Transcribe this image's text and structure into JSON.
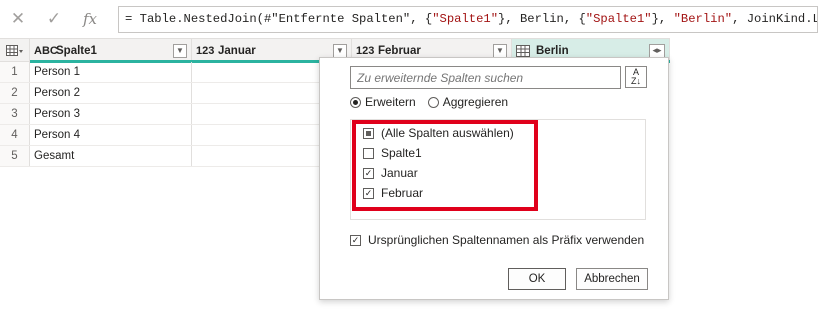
{
  "formula_bar": {
    "icons": [
      "cancel-icon",
      "confirm-icon",
      "fx-icon"
    ],
    "cancel_glyph": "✕",
    "confirm_glyph": "✓",
    "fx_glyph": "fx",
    "formula_parts": [
      {
        "text": "= Table.NestedJoin(#\"Entfernte Spalten\", {",
        "kind": "plain"
      },
      {
        "text": "\"Spalte1\"",
        "kind": "string"
      },
      {
        "text": "}, Berlin, {",
        "kind": "plain"
      },
      {
        "text": "\"Spalte1\"",
        "kind": "string"
      },
      {
        "text": "}, ",
        "kind": "plain"
      },
      {
        "text": "\"Berlin\"",
        "kind": "string"
      },
      {
        "text": ", JoinKind.LeftOuter)",
        "kind": "plain"
      }
    ]
  },
  "grid": {
    "columns": [
      {
        "type_label": "ABC",
        "name": "Spalte1"
      },
      {
        "type_label": "123",
        "name": "Januar"
      },
      {
        "type_label": "123",
        "name": "Februar"
      },
      {
        "type_label": "",
        "name": "Berlin"
      }
    ],
    "rows": [
      {
        "num": "1",
        "spalte1": "Person 1"
      },
      {
        "num": "2",
        "spalte1": "Person 2"
      },
      {
        "num": "3",
        "spalte1": "Person 3"
      },
      {
        "num": "4",
        "spalte1": "Person 4"
      },
      {
        "num": "5",
        "spalte1": "Gesamt"
      }
    ],
    "quality_color": "#2bb3a0"
  },
  "expand_popup": {
    "search_placeholder": "Zu erweiternde Spalten suchen",
    "sort_glyph_top": "A",
    "sort_glyph_bottom": "Z↓",
    "radio_expand": "Erweitern",
    "radio_aggregate": "Aggregieren",
    "radio_selected": "expand",
    "items": [
      {
        "label": "(Alle Spalten auswählen)",
        "state": "partial"
      },
      {
        "label": "Spalte1",
        "state": "unchecked"
      },
      {
        "label": "Januar",
        "state": "checked"
      },
      {
        "label": "Februar",
        "state": "checked"
      }
    ],
    "prefix_label": "Ursprünglichen Spaltennamen als Präfix verwenden",
    "prefix_checked": true,
    "ok_label": "OK",
    "cancel_label": "Abbrechen",
    "highlight_color": "#e0001b"
  }
}
